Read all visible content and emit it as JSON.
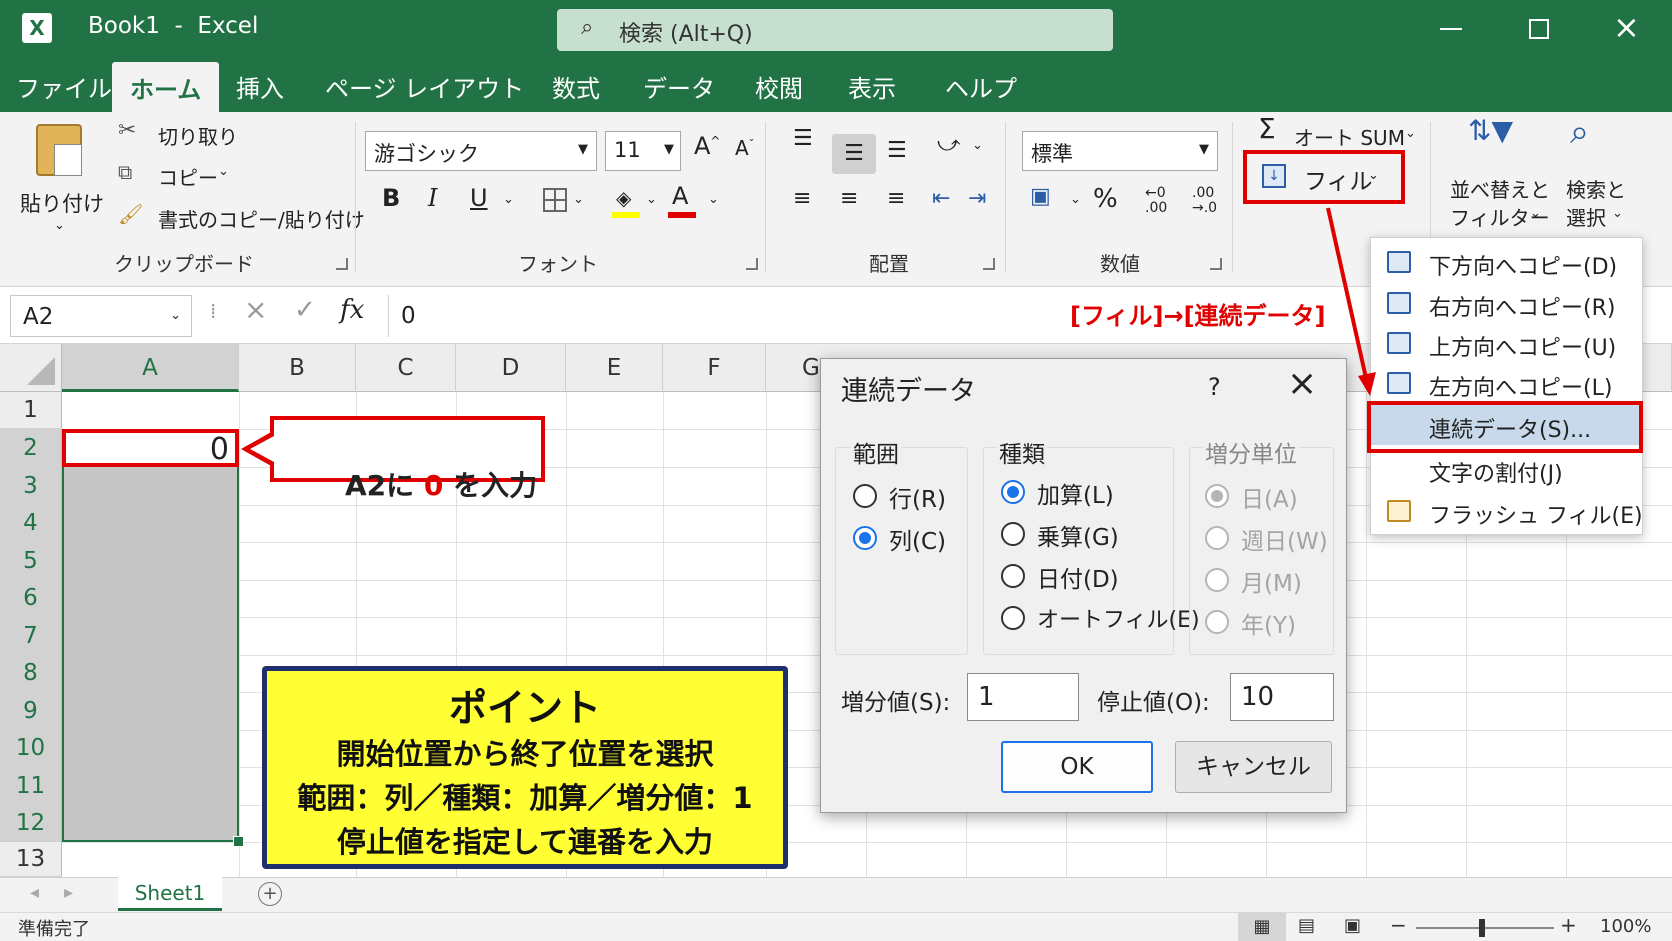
{
  "app": {
    "title": "Book1  -  Excel",
    "search_placeholder": "検索 (Alt+Q)"
  },
  "tabs": [
    "ファイル",
    "ホーム",
    "挿入",
    "ページ レイアウト",
    "数式",
    "データ",
    "校閲",
    "表示",
    "ヘルプ"
  ],
  "ribbon": {
    "clipboard": {
      "paste": "貼り付け",
      "cut": "切り取り",
      "copy": "コピー",
      "format_painter": "書式のコピー/貼り付け",
      "group": "クリップボード"
    },
    "font": {
      "name": "游ゴシック",
      "size": "11",
      "group": "フォント",
      "bold": "B",
      "italic": "I",
      "underline": "U"
    },
    "alignment": {
      "group": "配置"
    },
    "number": {
      "format": "標準",
      "group": "数値",
      "percent": "%"
    },
    "editing": {
      "autosum": "オート SUM",
      "fill": "フィル",
      "sort": [
        "並べ替えと",
        "フィルター"
      ],
      "find": [
        "検索と",
        "選択"
      ]
    }
  },
  "fill_menu": {
    "items": [
      "下方向へコピー(D)",
      "右方向へコピー(R)",
      "上方向へコピー(U)",
      "左方向へコピー(L)",
      "連続データ(S)...",
      "文字の割付(J)",
      "フラッシュ フィル(E)"
    ],
    "highlighted": "連続データ(S)..."
  },
  "annotation_fill": "[フィル]→[連続データ]",
  "formula_bar": {
    "name_box": "A2",
    "fx": "fx",
    "value": "0"
  },
  "grid": {
    "columns": [
      "A",
      "B",
      "C",
      "D",
      "E",
      "F",
      "G"
    ],
    "rows": [
      "1",
      "2",
      "3",
      "4",
      "5",
      "6",
      "7",
      "8",
      "9",
      "10",
      "11",
      "12",
      "13"
    ],
    "cell_a2": "0"
  },
  "callout_a2": {
    "prefix": "A2に ",
    "value": "0",
    "suffix": " を入力"
  },
  "point_box": {
    "title": "ポイント",
    "lines": [
      "開始位置から終了位置を選択",
      "範囲：列／種類：加算／増分値：1",
      "停止値を指定して連番を入力"
    ]
  },
  "dialog": {
    "title": "連続データ",
    "help": "?",
    "close": "×",
    "range": {
      "label": "範囲",
      "options": [
        "行(R)",
        "列(C)"
      ],
      "selected": "列(C)"
    },
    "type": {
      "label": "種類",
      "options": [
        "加算(L)",
        "乗算(G)",
        "日付(D)",
        "オートフィル(E)"
      ],
      "selected": "加算(L)"
    },
    "date_unit": {
      "label": "増分単位",
      "options": [
        "日(A)",
        "週日(W)",
        "月(M)",
        "年(Y)"
      ],
      "selected": "日(A)"
    },
    "step_label": "増分値(S):",
    "step_value": "1",
    "stop_label": "停止値(O):",
    "stop_value": "10",
    "ok": "OK",
    "cancel": "キャンセル"
  },
  "sheet_tab": "Sheet1",
  "status": {
    "ready": "準備完了",
    "zoom": "100%"
  },
  "colors": {
    "excel_green": "#217346",
    "red": "#e00000",
    "point_bg": "#ffff33",
    "point_border": "#1f2f6b"
  }
}
